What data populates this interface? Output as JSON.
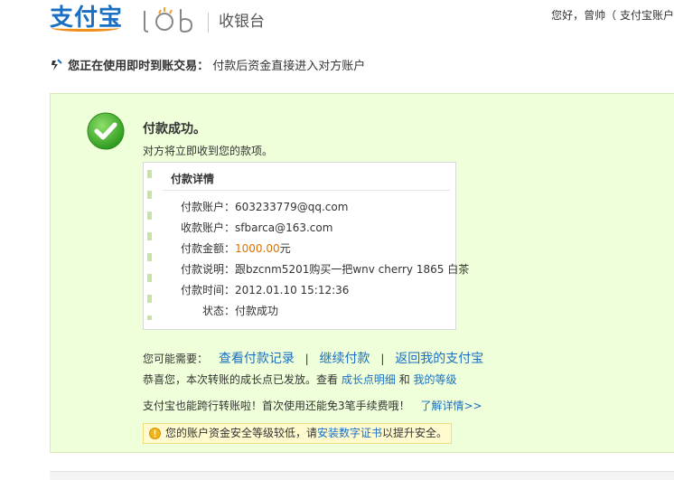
{
  "header": {
    "logo_text": "支付宝",
    "lab_text": "lab",
    "title": "收银台",
    "greeting": "您好，曾帅（  支付宝账户"
  },
  "notice": {
    "bold_text": "您正在使用即时到账交易：",
    "text": "付款后资金直接进入对方账户"
  },
  "result": {
    "title": "付款成功。",
    "subtitle": "对方将立即收到您的款项。"
  },
  "details": {
    "title": "付款详情",
    "rows": [
      {
        "label": "付款账户：",
        "value": "603233779@qq.com"
      },
      {
        "label": "收款账户：",
        "value": "sfbarca@163.com"
      },
      {
        "label": "付款金额：",
        "amount": "1000.00",
        "unit": "元"
      },
      {
        "label": "付款说明：",
        "value": "跟bzcnm5201购买一把wnv cherry 1865 白茶"
      },
      {
        "label": "付款时间：",
        "value": "2012.01.10 15:12:36"
      },
      {
        "label": "状态：",
        "value": "付款成功"
      }
    ]
  },
  "links": {
    "prefix": "您可能需要：",
    "view_records": "查看付款记录",
    "continue_pay": "继续付款",
    "back_home": "返回我的支付宝",
    "sep": "|"
  },
  "growth": {
    "text1": "恭喜您，本次转账的成长点已发放。查看",
    "growth_link": "成长点明细",
    "and": "和",
    "level_link": "我的等级"
  },
  "transfer": {
    "text": "支付宝也能跨行转账啦！首次使用还能免3笔手续费哦！",
    "link": "了解详情>>"
  },
  "warning": {
    "text1": "您的账户资金安全等级较低，请",
    "link": "安装数字证书",
    "text2": "以提升安全。"
  },
  "colors": {
    "brand_blue": "#1a6fc3",
    "panel_bg": "#efffd9",
    "amount_orange": "#e07000",
    "success_green": "#3aa829"
  },
  "icons": {
    "notice": "lightning-icon",
    "success": "check-circle-icon",
    "warning": "exclamation-icon"
  }
}
